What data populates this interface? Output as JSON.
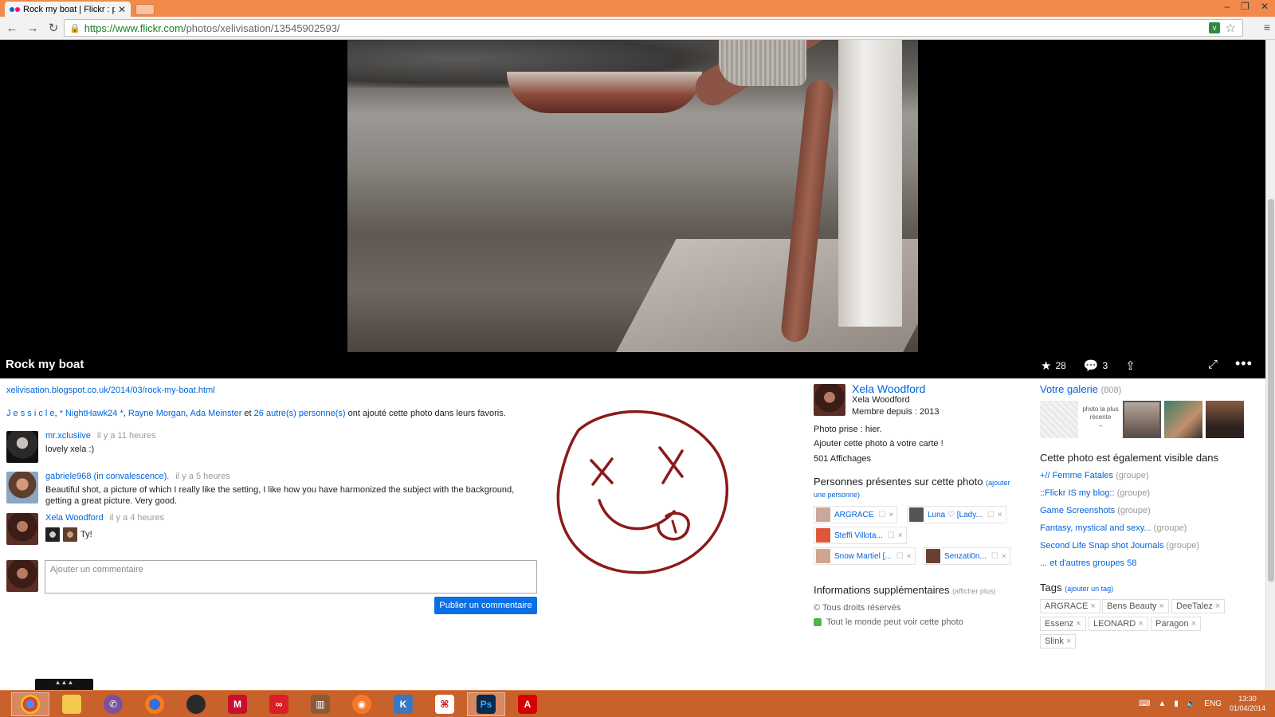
{
  "browser": {
    "tab_title": "Rock my boat | Flickr : par",
    "url_host": "https://www.flickr.com",
    "url_path": "/photos/xelivisation/13545902593/"
  },
  "photo": {
    "title": "Rock my boat",
    "favorites_count": "28",
    "comments_count": "3"
  },
  "description": {
    "blog_link": "xelivisation.blogspot.co.uk/2014/03/rock-my-boat.html"
  },
  "favorites": {
    "users": [
      "J e s s i c l e",
      "* NightHawk24 *",
      "Rayne Morgan",
      "Ada Meinster"
    ],
    "sep": ", ",
    "and": " et ",
    "others_link": "26 autre(s) personne(s)",
    "suffix": " ont ajouté cette photo dans leurs favoris."
  },
  "comments": [
    {
      "author": "mr.xclusiive",
      "time": "il y a 11 heures",
      "text": "lovely xela :)"
    },
    {
      "author": "gabriele968 (in convalescence).",
      "time": "il y a 5 heures",
      "text": "Beautiful shot, a picture of which I really like the setting, I like how you have harmonized the subject with the background, getting a great picture. Very good."
    },
    {
      "author": "Xela Woodford",
      "time": "il y a 4 heures",
      "text": "Ty!"
    }
  ],
  "compose": {
    "placeholder": "Ajouter un commentaire",
    "publish_label": "Publier un commentaire"
  },
  "owner": {
    "name": "Xela Woodford",
    "real_name": "Xela Woodford",
    "member_since": "Membre depuis : 2013",
    "taken": "Photo prise : hier.",
    "add_map": "Ajouter cette photo à votre carte !",
    "views": "501 Affichages"
  },
  "people": {
    "heading": "Personnes présentes sur cette photo",
    "add_link_a": "(ajouter",
    "add_link_b": "une personne)",
    "chips": [
      "ARGRACE",
      "Luna ♡ [Lady...",
      "Steffi Villota...",
      "Snow Martiel [...",
      "Senzati0n..."
    ]
  },
  "info": {
    "heading": "Informations supplémentaires",
    "more": "(afficher plus)",
    "rights": "Tous droits réservés",
    "visibility": "Tout le monde peut voir cette photo"
  },
  "gallery": {
    "heading": "Votre galerie",
    "count": "(808)",
    "recent_label": "photo la plus récente",
    "recent_arrow": "→"
  },
  "groups": {
    "heading": "Cette photo est également visible dans",
    "items": [
      {
        "name": "+// Femme Fatales",
        "kind": "(groupe)"
      },
      {
        "name": "::Flickr IS my blog::",
        "kind": "(groupe)"
      },
      {
        "name": "Game Screenshots",
        "kind": "(groupe)"
      },
      {
        "name": "Fantasy, mystical and sexy...",
        "kind": "(groupe)"
      },
      {
        "name": "Second Life Snap shot Journals",
        "kind": "(groupe)"
      }
    ],
    "more": "... et d'autres groupes 58"
  },
  "tags": {
    "heading": "Tags",
    "add_link": "(ajouter un tag)",
    "items": [
      "ARGRACE",
      "Bens Beauty",
      "DeeTalez",
      "Essenz",
      "LEONARD",
      "Paragon",
      "Slink"
    ]
  },
  "taskbar": {
    "lang": "ENG",
    "time": "13:30",
    "date": "01/04/2014",
    "apps": [
      "chrome",
      "explorer",
      "viber",
      "firefox",
      "recorder",
      "mcafee",
      "creative-cloud",
      "library",
      "blender",
      "kompozer",
      "acrobat",
      "photoshop",
      "adobe-reader"
    ]
  },
  "colors": {
    "accent": "#0063dc",
    "chrome": "#f28a4b",
    "taskbar": "#c9612b",
    "doodle": "#8b1a1a"
  }
}
